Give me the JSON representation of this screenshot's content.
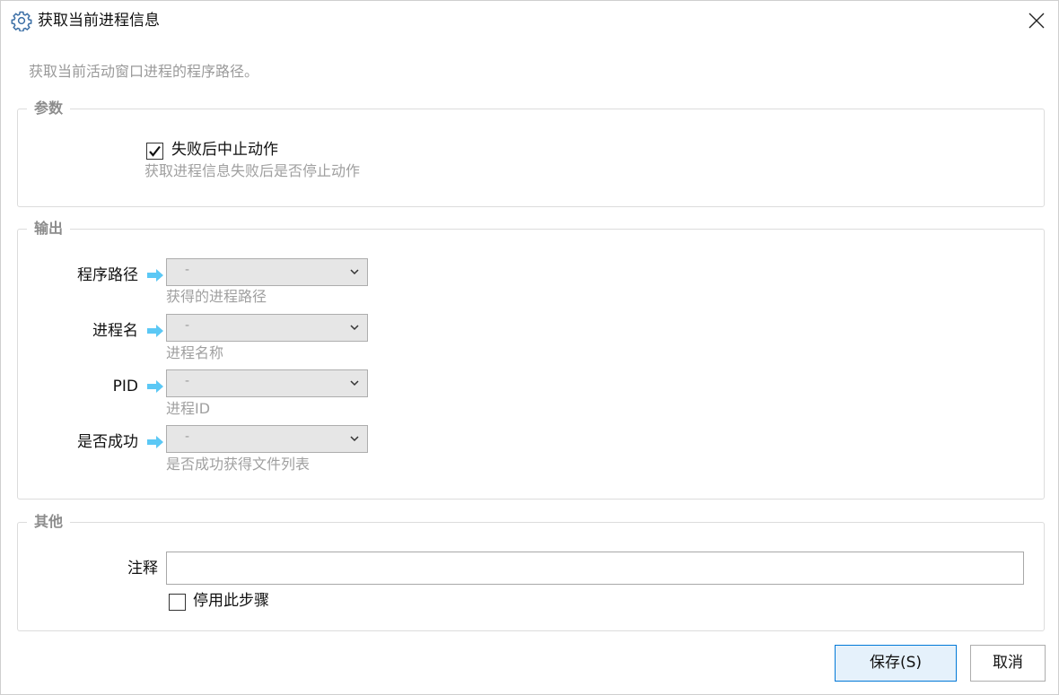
{
  "window": {
    "title": "获取当前进程信息",
    "description": "获取当前活动窗口进程的程序路径。"
  },
  "params": {
    "legend": "参数",
    "abort_on_fail": {
      "label": "失败后中止动作",
      "checked": true,
      "hint": "获取进程信息失败后是否停止动作"
    }
  },
  "output": {
    "legend": "输出",
    "rows": [
      {
        "label": "程序路径",
        "value": "-",
        "hint": "获得的进程路径"
      },
      {
        "label": "进程名",
        "value": "-",
        "hint": "进程名称"
      },
      {
        "label": "PID",
        "value": "-",
        "hint": "进程ID"
      },
      {
        "label": "是否成功",
        "value": "-",
        "hint": "是否成功获得文件列表"
      }
    ]
  },
  "other": {
    "legend": "其他",
    "note_label": "注释",
    "note_value": "",
    "disable_step": {
      "label": "停用此步骤",
      "checked": false
    }
  },
  "buttons": {
    "save": "保存(S)",
    "cancel": "取消"
  },
  "colors": {
    "accent_border": "#0078d7",
    "save_bg": "#e5f1fb",
    "arrow": "#5bc8f5",
    "hint_text": "#a0a0a0"
  }
}
